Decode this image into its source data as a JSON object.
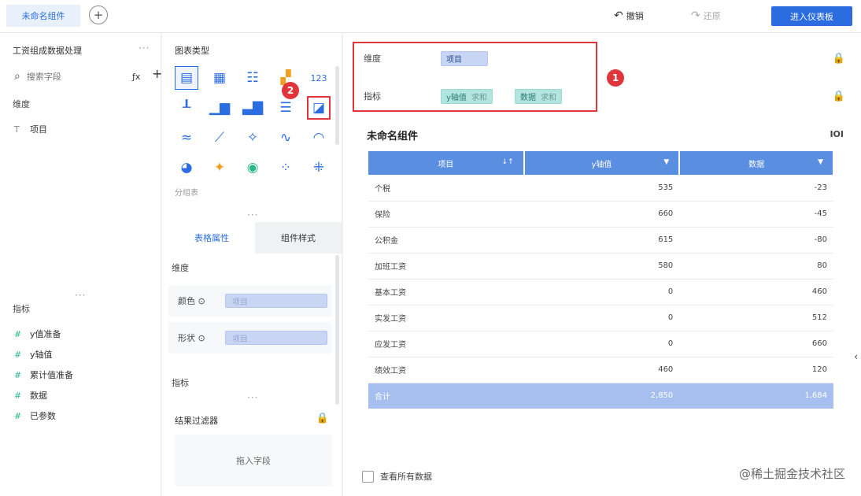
{
  "topbar": {
    "active_tab": "未命名组件",
    "undo_label": "撤销",
    "redo_label": "还原",
    "primary_button": "进入仪表板"
  },
  "field_panel": {
    "title": "工资组成数据处理",
    "search_placeholder": "搜索字段",
    "fx_label": "ƒx",
    "dimension_section": "维度",
    "dimensions": [
      {
        "type": "T",
        "label": "项目"
      }
    ],
    "measure_section": "指标",
    "measures": [
      {
        "type": "#",
        "label": "y值准备"
      },
      {
        "type": "#",
        "label": "y轴值"
      },
      {
        "type": "#",
        "label": "累计值准备"
      },
      {
        "type": "#",
        "label": "数据"
      },
      {
        "type": "#",
        "label": "已参数"
      }
    ]
  },
  "config_panel": {
    "chart_type_title": "图表类型",
    "chart_caption": "分组表",
    "tabs": [
      {
        "label": "表格属性",
        "active": true
      },
      {
        "label": "组件样式",
        "active": false
      }
    ],
    "dimension_label": "维度",
    "props": [
      {
        "label": "颜色",
        "slot": "项目"
      },
      {
        "label": "形状",
        "slot": "项目"
      }
    ],
    "measure_label": "指标",
    "filter_title": "结果过滤器",
    "drop_zone": "拖入字段"
  },
  "canvas": {
    "dimension_label": "维度",
    "dimension_pill": "项目",
    "measure_label": "指标",
    "measure_pills": [
      {
        "name": "y轴值",
        "agg": "求和"
      },
      {
        "name": "数据",
        "agg": "求和"
      }
    ],
    "widget_title": "未命名组件",
    "widget_icon": "IOI",
    "table": {
      "headers": [
        "项目",
        "y轴值",
        "数据"
      ],
      "rows": [
        [
          "个税",
          "535",
          "-23"
        ],
        [
          "保险",
          "660",
          "-45"
        ],
        [
          "公积金",
          "615",
          "-80"
        ],
        [
          "加班工资",
          "580",
          "80"
        ],
        [
          "基本工资",
          "0",
          "460"
        ],
        [
          "实发工资",
          "0",
          "512"
        ],
        [
          "应发工资",
          "0",
          "660"
        ],
        [
          "绩效工资",
          "460",
          "120"
        ]
      ],
      "total": [
        "合计",
        "2,850",
        "1,684"
      ]
    },
    "show_all_label": "查看所有数据"
  },
  "annotations": {
    "badge1": "1",
    "badge2": "2"
  },
  "watermark": "@稀土掘金技术社区",
  "colors": {
    "accent": "#2b6de0",
    "highlight": "#e0353b",
    "header": "#5a8ee0",
    "measure_pill": "#b3e5e0"
  }
}
